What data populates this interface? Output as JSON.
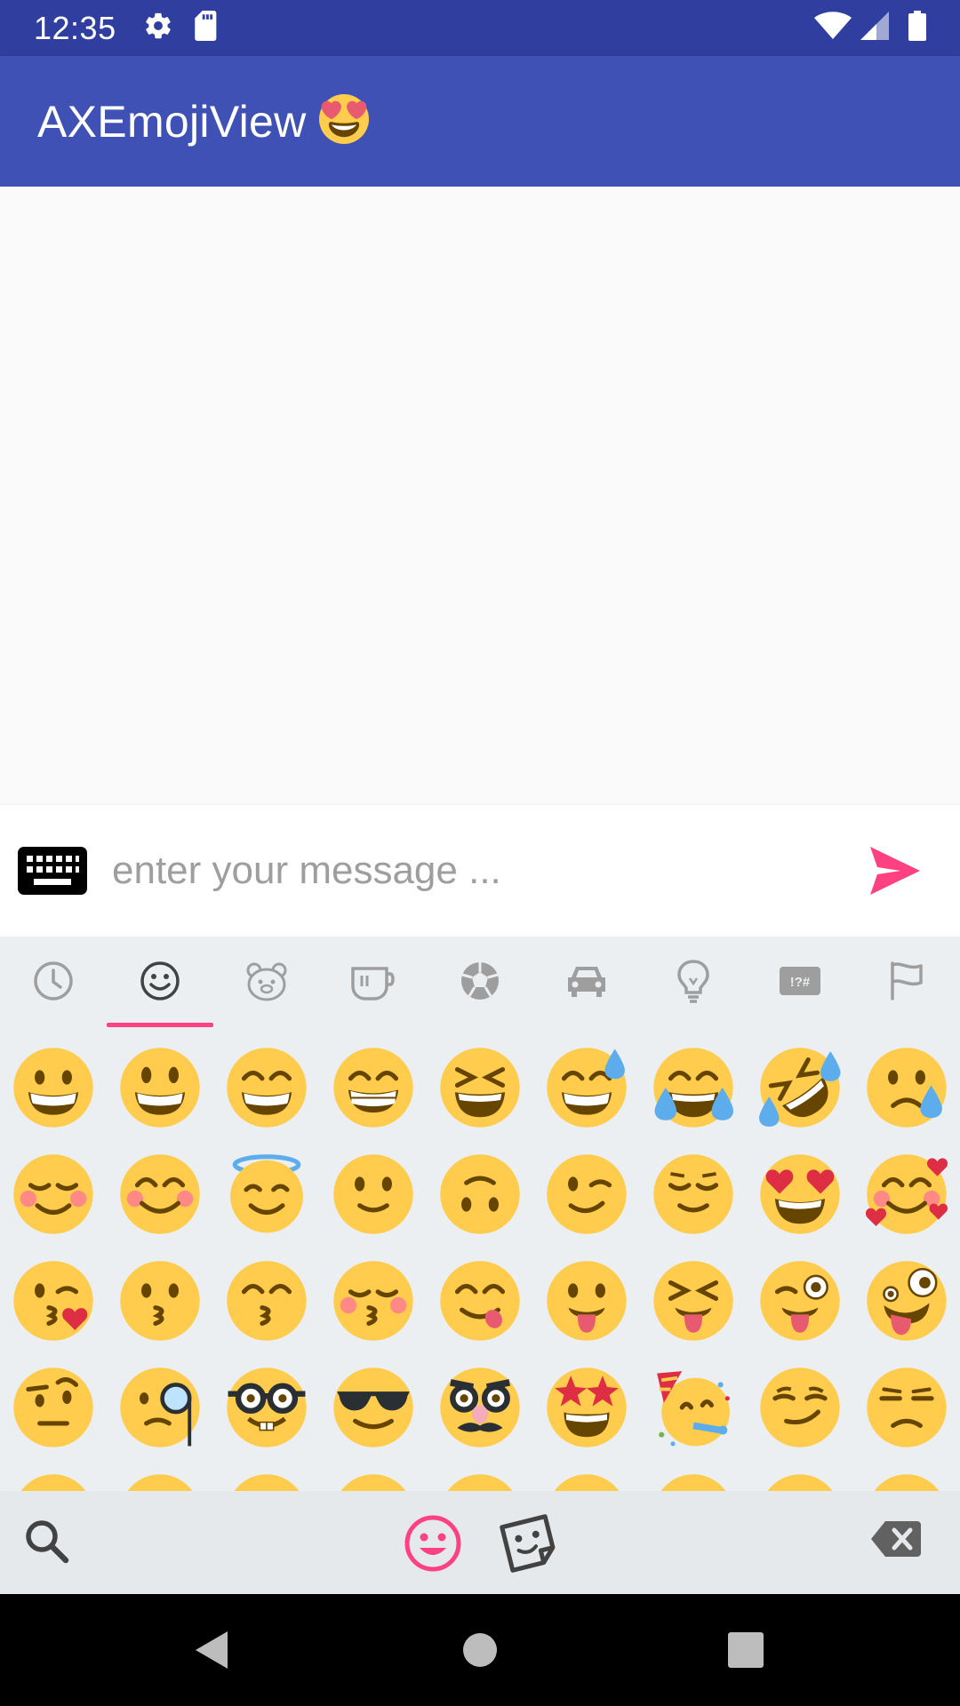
{
  "status_bar": {
    "time": "12:35",
    "left_icons": [
      "gear-icon",
      "sd-card-icon"
    ],
    "right_icons": [
      "wifi-icon",
      "cell-signal-icon",
      "battery-icon"
    ]
  },
  "app_bar": {
    "title": "AXEmojiView",
    "title_emoji": "heart-eyes-emoji"
  },
  "input_bar": {
    "placeholder": "enter your message ...",
    "value": "",
    "left_icon": "keyboard-icon",
    "right_icon": "send-icon"
  },
  "emoji_panel": {
    "categories": [
      {
        "name": "recent",
        "icon": "clock-icon",
        "active": false
      },
      {
        "name": "smileys",
        "icon": "smiley-icon",
        "active": true
      },
      {
        "name": "animals",
        "icon": "bear-icon",
        "active": false
      },
      {
        "name": "food",
        "icon": "cup-icon",
        "active": false
      },
      {
        "name": "activities",
        "icon": "soccer-ball-icon",
        "active": false
      },
      {
        "name": "travel",
        "icon": "car-icon",
        "active": false
      },
      {
        "name": "objects",
        "icon": "lightbulb-icon",
        "active": false
      },
      {
        "name": "symbols",
        "icon": "symbols-icon",
        "active": false
      },
      {
        "name": "flags",
        "icon": "flag-icon",
        "active": false
      }
    ],
    "emojis": [
      "grinning",
      "smiley",
      "smile",
      "grin",
      "laughing",
      "sweat-smile",
      "joy",
      "rofl",
      "crying-face",
      "relaxed",
      "blush",
      "innocent",
      "slightly-smiling",
      "upside-down",
      "wink",
      "relieved",
      "heart-eyes",
      "smiling-hearts",
      "kissing-heart",
      "kissing",
      "kissing-smiling-eyes",
      "kissing-closed-eyes",
      "yum",
      "stuck-out-tongue",
      "squinting-tongue",
      "winking-tongue",
      "zany",
      "raised-eyebrow",
      "monocle",
      "nerd",
      "sunglasses",
      "disguised",
      "star-struck",
      "partying",
      "smirk",
      "unamused",
      "pensive",
      "worried",
      "confused",
      "slight-frown",
      "frowning",
      "persevere",
      "confounded",
      "tired",
      "weary"
    ],
    "accent_color": "#ff4081",
    "icon_color": "#9e9e9e"
  },
  "emoji_bottom_bar": {
    "left_icon": "search-icon",
    "center_icons": [
      "emoji-mode-icon",
      "sticker-mode-icon"
    ],
    "right_icon": "backspace-icon"
  },
  "nav_bar": {
    "icons": [
      "back-icon",
      "home-icon",
      "recents-icon"
    ]
  },
  "colors": {
    "status_bar": "#303f9f",
    "app_bar": "#3f51b5",
    "emoji_yellow": "#ffcc4d",
    "emoji_features": "#664500",
    "tongue": "#e75a70",
    "heart": "#dd2e44",
    "tear": "#5dadec"
  }
}
